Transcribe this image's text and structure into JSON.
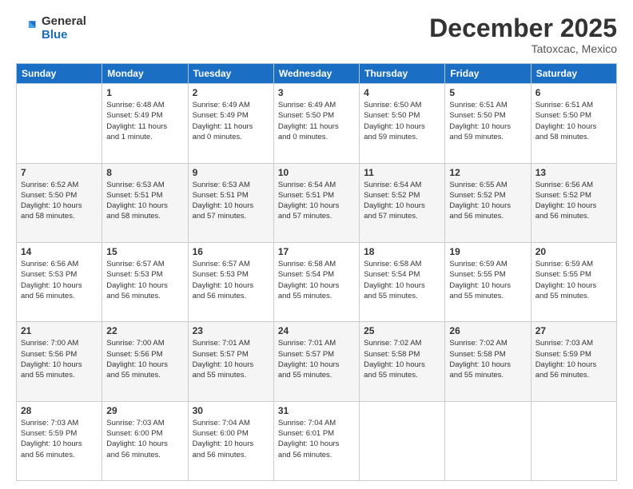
{
  "header": {
    "logo_general": "General",
    "logo_blue": "Blue",
    "month_title": "December 2025",
    "location": "Tatoxcac, Mexico"
  },
  "columns": [
    "Sunday",
    "Monday",
    "Tuesday",
    "Wednesday",
    "Thursday",
    "Friday",
    "Saturday"
  ],
  "weeks": [
    [
      {
        "day": "",
        "info": ""
      },
      {
        "day": "1",
        "info": "Sunrise: 6:48 AM\nSunset: 5:49 PM\nDaylight: 11 hours\nand 1 minute."
      },
      {
        "day": "2",
        "info": "Sunrise: 6:49 AM\nSunset: 5:49 PM\nDaylight: 11 hours\nand 0 minutes."
      },
      {
        "day": "3",
        "info": "Sunrise: 6:49 AM\nSunset: 5:50 PM\nDaylight: 11 hours\nand 0 minutes."
      },
      {
        "day": "4",
        "info": "Sunrise: 6:50 AM\nSunset: 5:50 PM\nDaylight: 10 hours\nand 59 minutes."
      },
      {
        "day": "5",
        "info": "Sunrise: 6:51 AM\nSunset: 5:50 PM\nDaylight: 10 hours\nand 59 minutes."
      },
      {
        "day": "6",
        "info": "Sunrise: 6:51 AM\nSunset: 5:50 PM\nDaylight: 10 hours\nand 58 minutes."
      }
    ],
    [
      {
        "day": "7",
        "info": "Sunrise: 6:52 AM\nSunset: 5:50 PM\nDaylight: 10 hours\nand 58 minutes."
      },
      {
        "day": "8",
        "info": "Sunrise: 6:53 AM\nSunset: 5:51 PM\nDaylight: 10 hours\nand 58 minutes."
      },
      {
        "day": "9",
        "info": "Sunrise: 6:53 AM\nSunset: 5:51 PM\nDaylight: 10 hours\nand 57 minutes."
      },
      {
        "day": "10",
        "info": "Sunrise: 6:54 AM\nSunset: 5:51 PM\nDaylight: 10 hours\nand 57 minutes."
      },
      {
        "day": "11",
        "info": "Sunrise: 6:54 AM\nSunset: 5:52 PM\nDaylight: 10 hours\nand 57 minutes."
      },
      {
        "day": "12",
        "info": "Sunrise: 6:55 AM\nSunset: 5:52 PM\nDaylight: 10 hours\nand 56 minutes."
      },
      {
        "day": "13",
        "info": "Sunrise: 6:56 AM\nSunset: 5:52 PM\nDaylight: 10 hours\nand 56 minutes."
      }
    ],
    [
      {
        "day": "14",
        "info": "Sunrise: 6:56 AM\nSunset: 5:53 PM\nDaylight: 10 hours\nand 56 minutes."
      },
      {
        "day": "15",
        "info": "Sunrise: 6:57 AM\nSunset: 5:53 PM\nDaylight: 10 hours\nand 56 minutes."
      },
      {
        "day": "16",
        "info": "Sunrise: 6:57 AM\nSunset: 5:53 PM\nDaylight: 10 hours\nand 56 minutes."
      },
      {
        "day": "17",
        "info": "Sunrise: 6:58 AM\nSunset: 5:54 PM\nDaylight: 10 hours\nand 55 minutes."
      },
      {
        "day": "18",
        "info": "Sunrise: 6:58 AM\nSunset: 5:54 PM\nDaylight: 10 hours\nand 55 minutes."
      },
      {
        "day": "19",
        "info": "Sunrise: 6:59 AM\nSunset: 5:55 PM\nDaylight: 10 hours\nand 55 minutes."
      },
      {
        "day": "20",
        "info": "Sunrise: 6:59 AM\nSunset: 5:55 PM\nDaylight: 10 hours\nand 55 minutes."
      }
    ],
    [
      {
        "day": "21",
        "info": "Sunrise: 7:00 AM\nSunset: 5:56 PM\nDaylight: 10 hours\nand 55 minutes."
      },
      {
        "day": "22",
        "info": "Sunrise: 7:00 AM\nSunset: 5:56 PM\nDaylight: 10 hours\nand 55 minutes."
      },
      {
        "day": "23",
        "info": "Sunrise: 7:01 AM\nSunset: 5:57 PM\nDaylight: 10 hours\nand 55 minutes."
      },
      {
        "day": "24",
        "info": "Sunrise: 7:01 AM\nSunset: 5:57 PM\nDaylight: 10 hours\nand 55 minutes."
      },
      {
        "day": "25",
        "info": "Sunrise: 7:02 AM\nSunset: 5:58 PM\nDaylight: 10 hours\nand 55 minutes."
      },
      {
        "day": "26",
        "info": "Sunrise: 7:02 AM\nSunset: 5:58 PM\nDaylight: 10 hours\nand 55 minutes."
      },
      {
        "day": "27",
        "info": "Sunrise: 7:03 AM\nSunset: 5:59 PM\nDaylight: 10 hours\nand 56 minutes."
      }
    ],
    [
      {
        "day": "28",
        "info": "Sunrise: 7:03 AM\nSunset: 5:59 PM\nDaylight: 10 hours\nand 56 minutes."
      },
      {
        "day": "29",
        "info": "Sunrise: 7:03 AM\nSunset: 6:00 PM\nDaylight: 10 hours\nand 56 minutes."
      },
      {
        "day": "30",
        "info": "Sunrise: 7:04 AM\nSunset: 6:00 PM\nDaylight: 10 hours\nand 56 minutes."
      },
      {
        "day": "31",
        "info": "Sunrise: 7:04 AM\nSunset: 6:01 PM\nDaylight: 10 hours\nand 56 minutes."
      },
      {
        "day": "",
        "info": ""
      },
      {
        "day": "",
        "info": ""
      },
      {
        "day": "",
        "info": ""
      }
    ]
  ]
}
